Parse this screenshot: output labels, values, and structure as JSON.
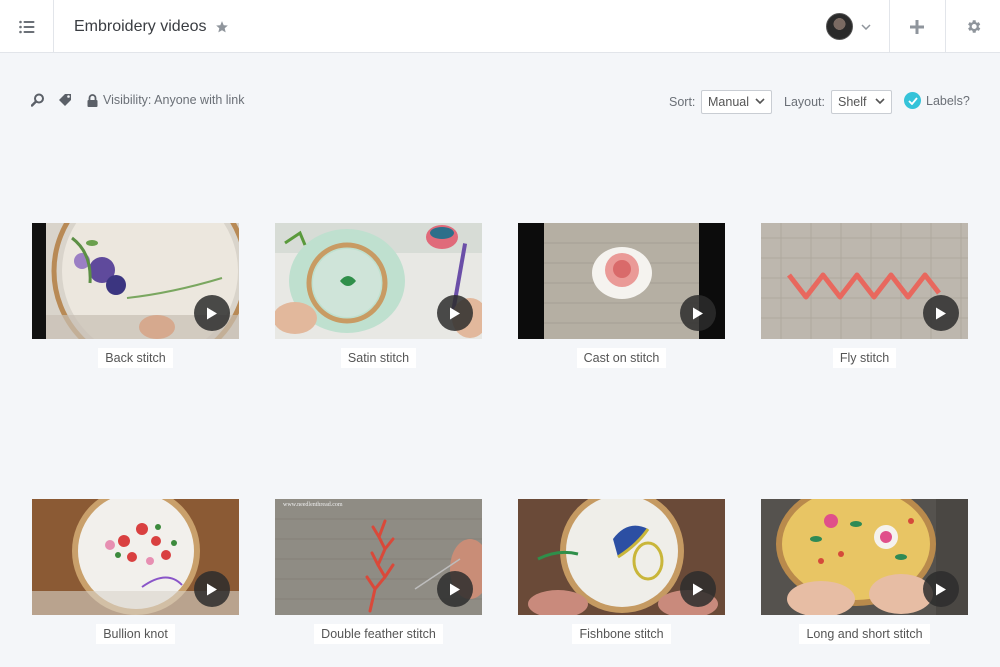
{
  "header": {
    "title": "Embroidery videos",
    "icons": [
      "list-icon",
      "star-icon",
      "avatar",
      "chevron-down-icon",
      "plus-icon",
      "gear-icon"
    ]
  },
  "toolbar": {
    "visibility_label": "Visibility: Anyone with link",
    "sort_label": "Sort:",
    "sort_value": "Manual",
    "layout_label": "Layout:",
    "layout_value": "Shelf",
    "labels_label": "Labels?",
    "labels_checked": true,
    "accent_color": "#35c3d9"
  },
  "videos": [
    {
      "caption": "Back stitch"
    },
    {
      "caption": "Satin stitch"
    },
    {
      "caption": "Cast on stitch"
    },
    {
      "caption": "Fly stitch"
    },
    {
      "caption": "Bullion knot"
    },
    {
      "caption": "Double feather stitch"
    },
    {
      "caption": "Fishbone stitch"
    },
    {
      "caption": "Long and short stitch"
    }
  ],
  "watermark": "www.needlenthread.com"
}
